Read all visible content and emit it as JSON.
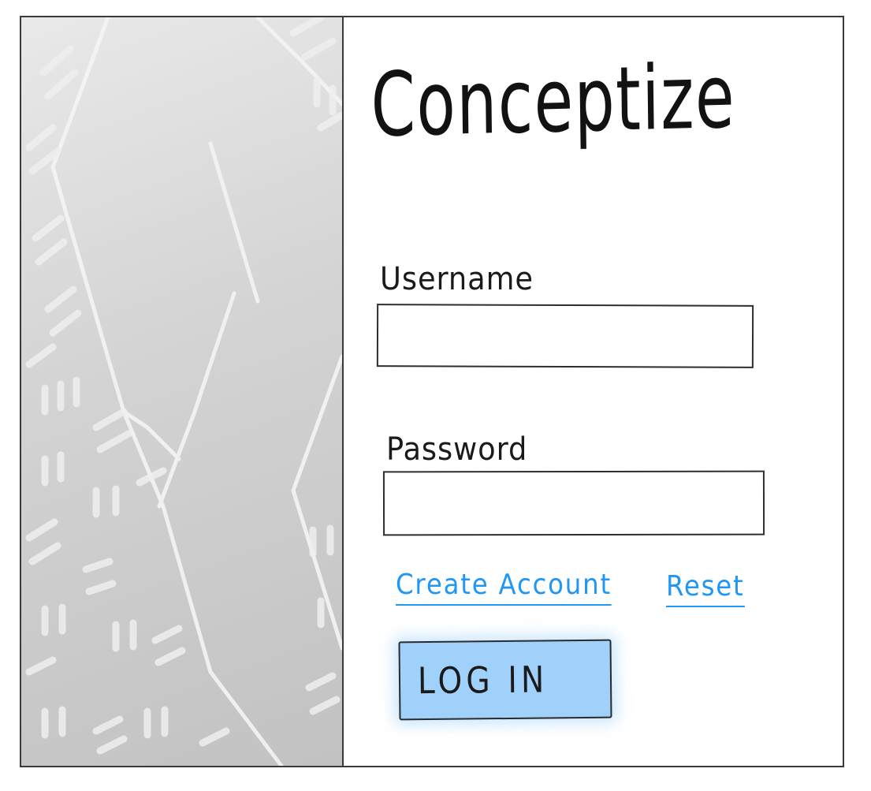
{
  "app": {
    "title": "Conceptize"
  },
  "login_form": {
    "username_label": "Username",
    "username_value": "",
    "password_label": "Password",
    "password_value": "",
    "create_account_link": "Create Account",
    "reset_link": "Reset",
    "login_button": "LOG IN"
  },
  "colors": {
    "link": "#2196f3",
    "button_fill": "#9fd1fb",
    "hero_panel": "#c8c8c8"
  },
  "icons": {
    "hero_decoration": "abstract-line-pattern"
  }
}
